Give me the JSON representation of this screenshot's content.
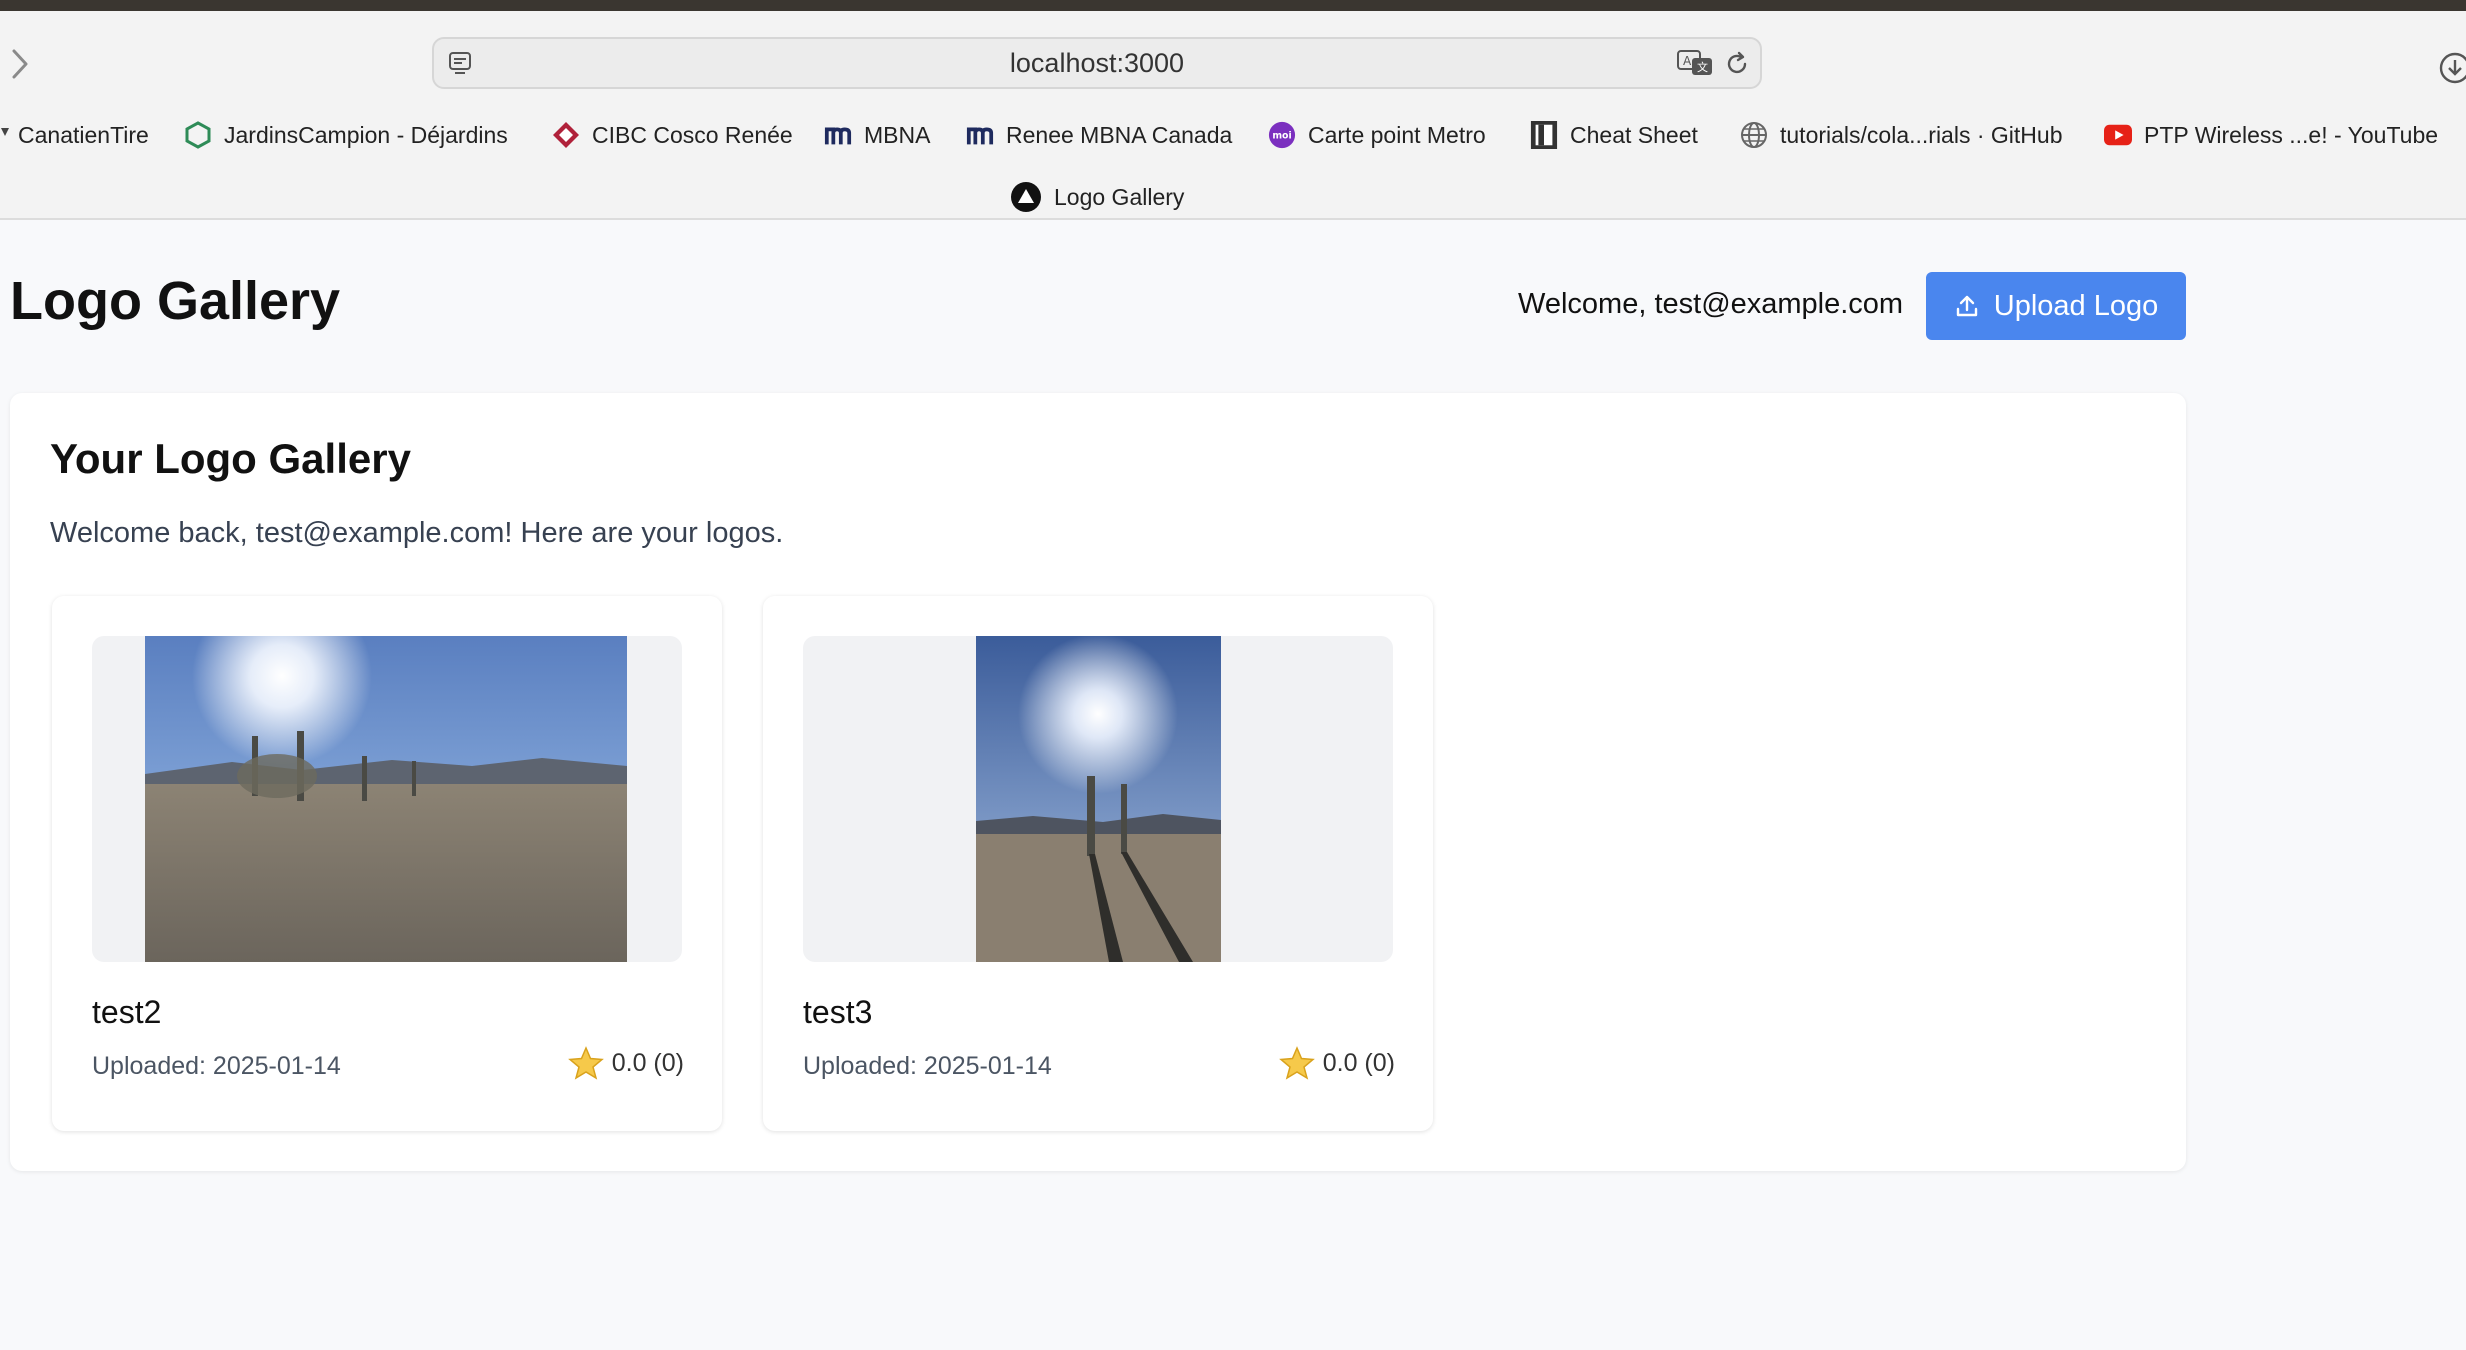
{
  "browser": {
    "url": "localhost:3000",
    "bookmarks": [
      {
        "label": "CanatienTire",
        "icon": "bookmark-mark-icon"
      },
      {
        "label": "JardinsCampion - Déjardins",
        "icon": "hexagon-icon"
      },
      {
        "label": "CIBC Cosco Renée",
        "icon": "cibc-logo-icon"
      },
      {
        "label": "MBNA",
        "icon": "mbna-logo-icon"
      },
      {
        "label": "Renee MBNA Canada",
        "icon": "mbna-logo-icon"
      },
      {
        "label": "Carte point Metro",
        "icon": "moi-logo-icon"
      },
      {
        "label": "Cheat Sheet",
        "icon": "bracket-logo-icon"
      },
      {
        "label": "tutorials/cola...rials · GitHub",
        "icon": "globe-icon"
      },
      {
        "label": "PTP Wireless ...e! - YouTube",
        "icon": "youtube-icon"
      }
    ],
    "bookmark_row2": {
      "label": "Logo Gallery",
      "icon": "triangle-logo-icon"
    },
    "moi_text": "moi"
  },
  "header": {
    "title": "Logo Gallery",
    "welcome": "Welcome, test@example.com",
    "upload_label": "Upload Logo"
  },
  "gallery": {
    "title": "Your Logo Gallery",
    "subtitle": "Welcome back, test@example.com! Here are your logos.",
    "cards": [
      {
        "name": "test2",
        "uploaded": "Uploaded: 2025-01-14",
        "rating": "0.0 (0)"
      },
      {
        "name": "test3",
        "uploaded": "Uploaded: 2025-01-14",
        "rating": "0.0 (0)"
      }
    ]
  },
  "colors": {
    "accent": "#4a86ee",
    "page_bg": "#f8f9fb",
    "card_bg": "#ffffff"
  }
}
